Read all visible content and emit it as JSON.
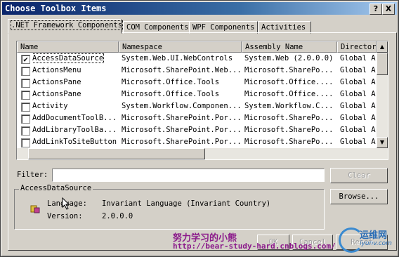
{
  "window": {
    "title": "Choose Toolbox Items",
    "help": "?",
    "close": "X"
  },
  "tabs": [
    {
      "label": ".NET Framework Components"
    },
    {
      "label": "COM Components"
    },
    {
      "label": "WPF Components"
    },
    {
      "label": "Activities"
    }
  ],
  "columns": [
    "Name",
    "Namespace",
    "Assembly Name",
    "Director"
  ],
  "rows": [
    {
      "checked": true,
      "name": "AccessDataSource",
      "namespace": "System.Web.UI.WebControls",
      "assembly": "System.Web (2.0.0.0)",
      "dir": "Global A"
    },
    {
      "checked": false,
      "name": "ActionsMenu",
      "namespace": "Microsoft.SharePoint.Web...",
      "assembly": "Microsoft.SharePo...",
      "dir": "Global A"
    },
    {
      "checked": false,
      "name": "ActionsPane",
      "namespace": "Microsoft.Office.Tools",
      "assembly": "Microsoft.Office....",
      "dir": "Global A"
    },
    {
      "checked": false,
      "name": "ActionsPane",
      "namespace": "Microsoft.Office.Tools",
      "assembly": "Microsoft.Office....",
      "dir": "Global A"
    },
    {
      "checked": false,
      "name": "Activity",
      "namespace": "System.Workflow.Componen...",
      "assembly": "System.Workflow.C...",
      "dir": "Global A"
    },
    {
      "checked": false,
      "name": "AddDocumentToolB...",
      "namespace": "Microsoft.SharePoint.Por...",
      "assembly": "Microsoft.SharePo...",
      "dir": "Global A"
    },
    {
      "checked": false,
      "name": "AddLibraryToolBa...",
      "namespace": "Microsoft.SharePoint.Por...",
      "assembly": "Microsoft.SharePo...",
      "dir": "Global A"
    },
    {
      "checked": false,
      "name": "AddLinkToSiteButton",
      "namespace": "Microsoft.SharePoint.Por...",
      "assembly": "Microsoft.SharePo...",
      "dir": "Global A"
    }
  ],
  "filter": {
    "label": "Filter:",
    "value": "",
    "clear": "Clear"
  },
  "details": {
    "group": "AccessDataSource",
    "language_label": "Language:",
    "language_value": "Invariant Language (Invariant Country)",
    "version_label": "Version:",
    "version_value": "2.0.0.0",
    "browse": "Browse..."
  },
  "footer": {
    "ok": "OK",
    "cancel": "Cancel",
    "reset": "Reset"
  },
  "watermark": {
    "cn": "努力学习的小熊",
    "url": "http://bear-study-hard.cnblogs.com/",
    "site": "运维网",
    "site_url": "iyunv.com"
  },
  "colors": {
    "title_start": "#0a246a",
    "title_end": "#a6caf0",
    "window": "#d4d0c8"
  }
}
